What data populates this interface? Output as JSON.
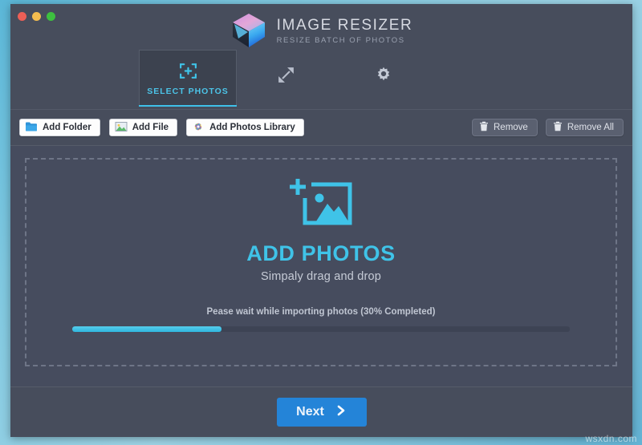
{
  "window": {
    "traffic_lights": [
      {
        "name": "close",
        "color": "#ec5f56"
      },
      {
        "name": "minimize",
        "color": "#f4bd4f"
      },
      {
        "name": "zoom",
        "color": "#3dc03f"
      }
    ]
  },
  "brand": {
    "title": "IMAGE RESIZER",
    "subtitle": "RESIZE BATCH OF PHOTOS",
    "logo_icon": "cube-logo-icon"
  },
  "tabs": [
    {
      "label": "SELECT PHOTOS",
      "icon": "select-photos-icon",
      "active": true
    },
    {
      "label": "",
      "icon": "resize-arrows-icon",
      "active": false
    },
    {
      "label": "",
      "icon": "gear-icon",
      "active": false
    }
  ],
  "toolbar": {
    "left_buttons": [
      {
        "label": "Add Folder",
        "icon": "folder-icon"
      },
      {
        "label": "Add File",
        "icon": "image-file-icon"
      },
      {
        "label": "Add Photos Library",
        "icon": "photos-library-icon"
      }
    ],
    "right_buttons": [
      {
        "label": "Remove",
        "icon": "trash-icon"
      },
      {
        "label": "Remove All",
        "icon": "trash-icon"
      }
    ]
  },
  "dropzone": {
    "icon": "add-photo-icon",
    "title": "ADD PHOTOS",
    "subtitle": "Simpaly drag and drop",
    "status_text": "Pease wait while importing photos (30% Completed)",
    "progress_percent": 30
  },
  "footer": {
    "next_label": "Next",
    "next_icon": "chevron-right-icon"
  },
  "watermark": "wsxdn.com",
  "colors": {
    "accent_cyan": "#3fc3e8",
    "accent_blue": "#2484d8",
    "header_bg": "#474d5c",
    "main_bg": "#464c5e",
    "tab_active_bg": "#3c424f"
  }
}
